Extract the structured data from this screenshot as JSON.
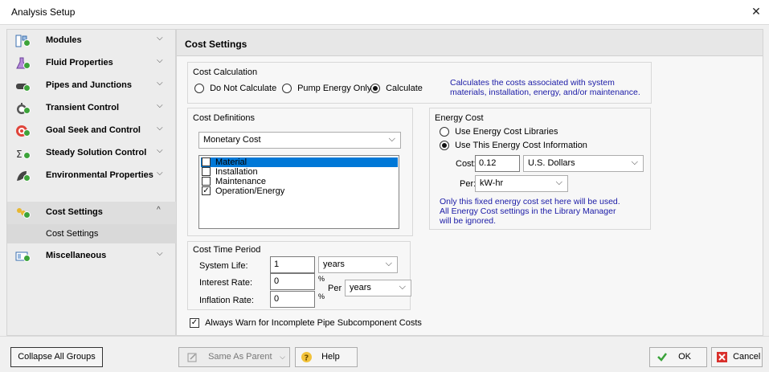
{
  "window": {
    "title": "Analysis Setup",
    "close_glyph": "✕"
  },
  "sidebar": {
    "items": [
      {
        "label": "Modules",
        "icon": "modules-icon",
        "chev": "⌵"
      },
      {
        "label": "Fluid Properties",
        "icon": "flask-icon",
        "chev": "⌵"
      },
      {
        "label": "Pipes and Junctions",
        "icon": "pipe-icon",
        "chev": "⌵"
      },
      {
        "label": "Transient Control",
        "icon": "stopwatch-icon",
        "chev": "⌵"
      },
      {
        "label": "Goal Seek and Control",
        "icon": "target-icon",
        "chev": "⌵"
      },
      {
        "label": "Steady Solution Control",
        "icon": "solver-icon",
        "chev": "⌵"
      },
      {
        "label": "Environmental Properties",
        "icon": "environment-icon",
        "chev": "⌵"
      },
      {
        "label": "Cost Settings",
        "icon": "cost-icon",
        "chev": "^"
      },
      {
        "label": "Miscellaneous",
        "icon": "misc-icon",
        "chev": "⌵"
      }
    ],
    "sub_item": "Cost Settings"
  },
  "main": {
    "header": "Cost Settings",
    "cost_calculation": {
      "title": "Cost Calculation",
      "options": [
        "Do Not Calculate",
        "Pump Energy Only",
        "Calculate"
      ],
      "selected": 2,
      "description": "Calculates the costs associated with system materials, installation, energy, and/or maintenance."
    },
    "cost_definitions": {
      "title": "Cost Definitions",
      "dropdown_value": "Monetary Cost",
      "items": [
        {
          "label": "Material",
          "checked": false,
          "selected": true
        },
        {
          "label": "Installation",
          "checked": false,
          "selected": false
        },
        {
          "label": "Maintenance",
          "checked": false,
          "selected": false
        },
        {
          "label": "Operation/Energy",
          "checked": true,
          "selected": false
        }
      ]
    },
    "energy_cost": {
      "title": "Energy Cost",
      "options": [
        "Use Energy Cost Libraries",
        "Use This Energy Cost Information"
      ],
      "selected": 1,
      "cost_label": "Cost:",
      "cost_value": "0.12",
      "currency": "U.S. Dollars",
      "per_label": "Per:",
      "per_unit": "kW-hr",
      "note": "Only this fixed energy cost set here will be used. All Energy Cost settings in the Library Manager will be ignored."
    },
    "cost_time_period": {
      "title": "Cost Time Period",
      "system_life_label": "System Life:",
      "system_life_value": "1",
      "system_life_unit": "years",
      "interest_label": "Interest Rate:",
      "interest_value": "0",
      "inflation_label": "Inflation Rate:",
      "inflation_value": "0",
      "percent": "%",
      "per_label": "Per",
      "per_unit": "years"
    },
    "warn_checkbox": {
      "label": "Always Warn for Incomplete Pipe Subcomponent Costs",
      "checked": true
    }
  },
  "footer": {
    "collapse_label": "Collapse All Groups",
    "same_as_parent_label": "Same As Parent",
    "help_label": "Help",
    "ok_label": "OK",
    "cancel_label": "Cancel"
  },
  "colors": {
    "accent": "#0078d7",
    "note_text": "#1a1aa6",
    "ok_check": "#3aa33a",
    "cancel_red": "#d9302c"
  }
}
